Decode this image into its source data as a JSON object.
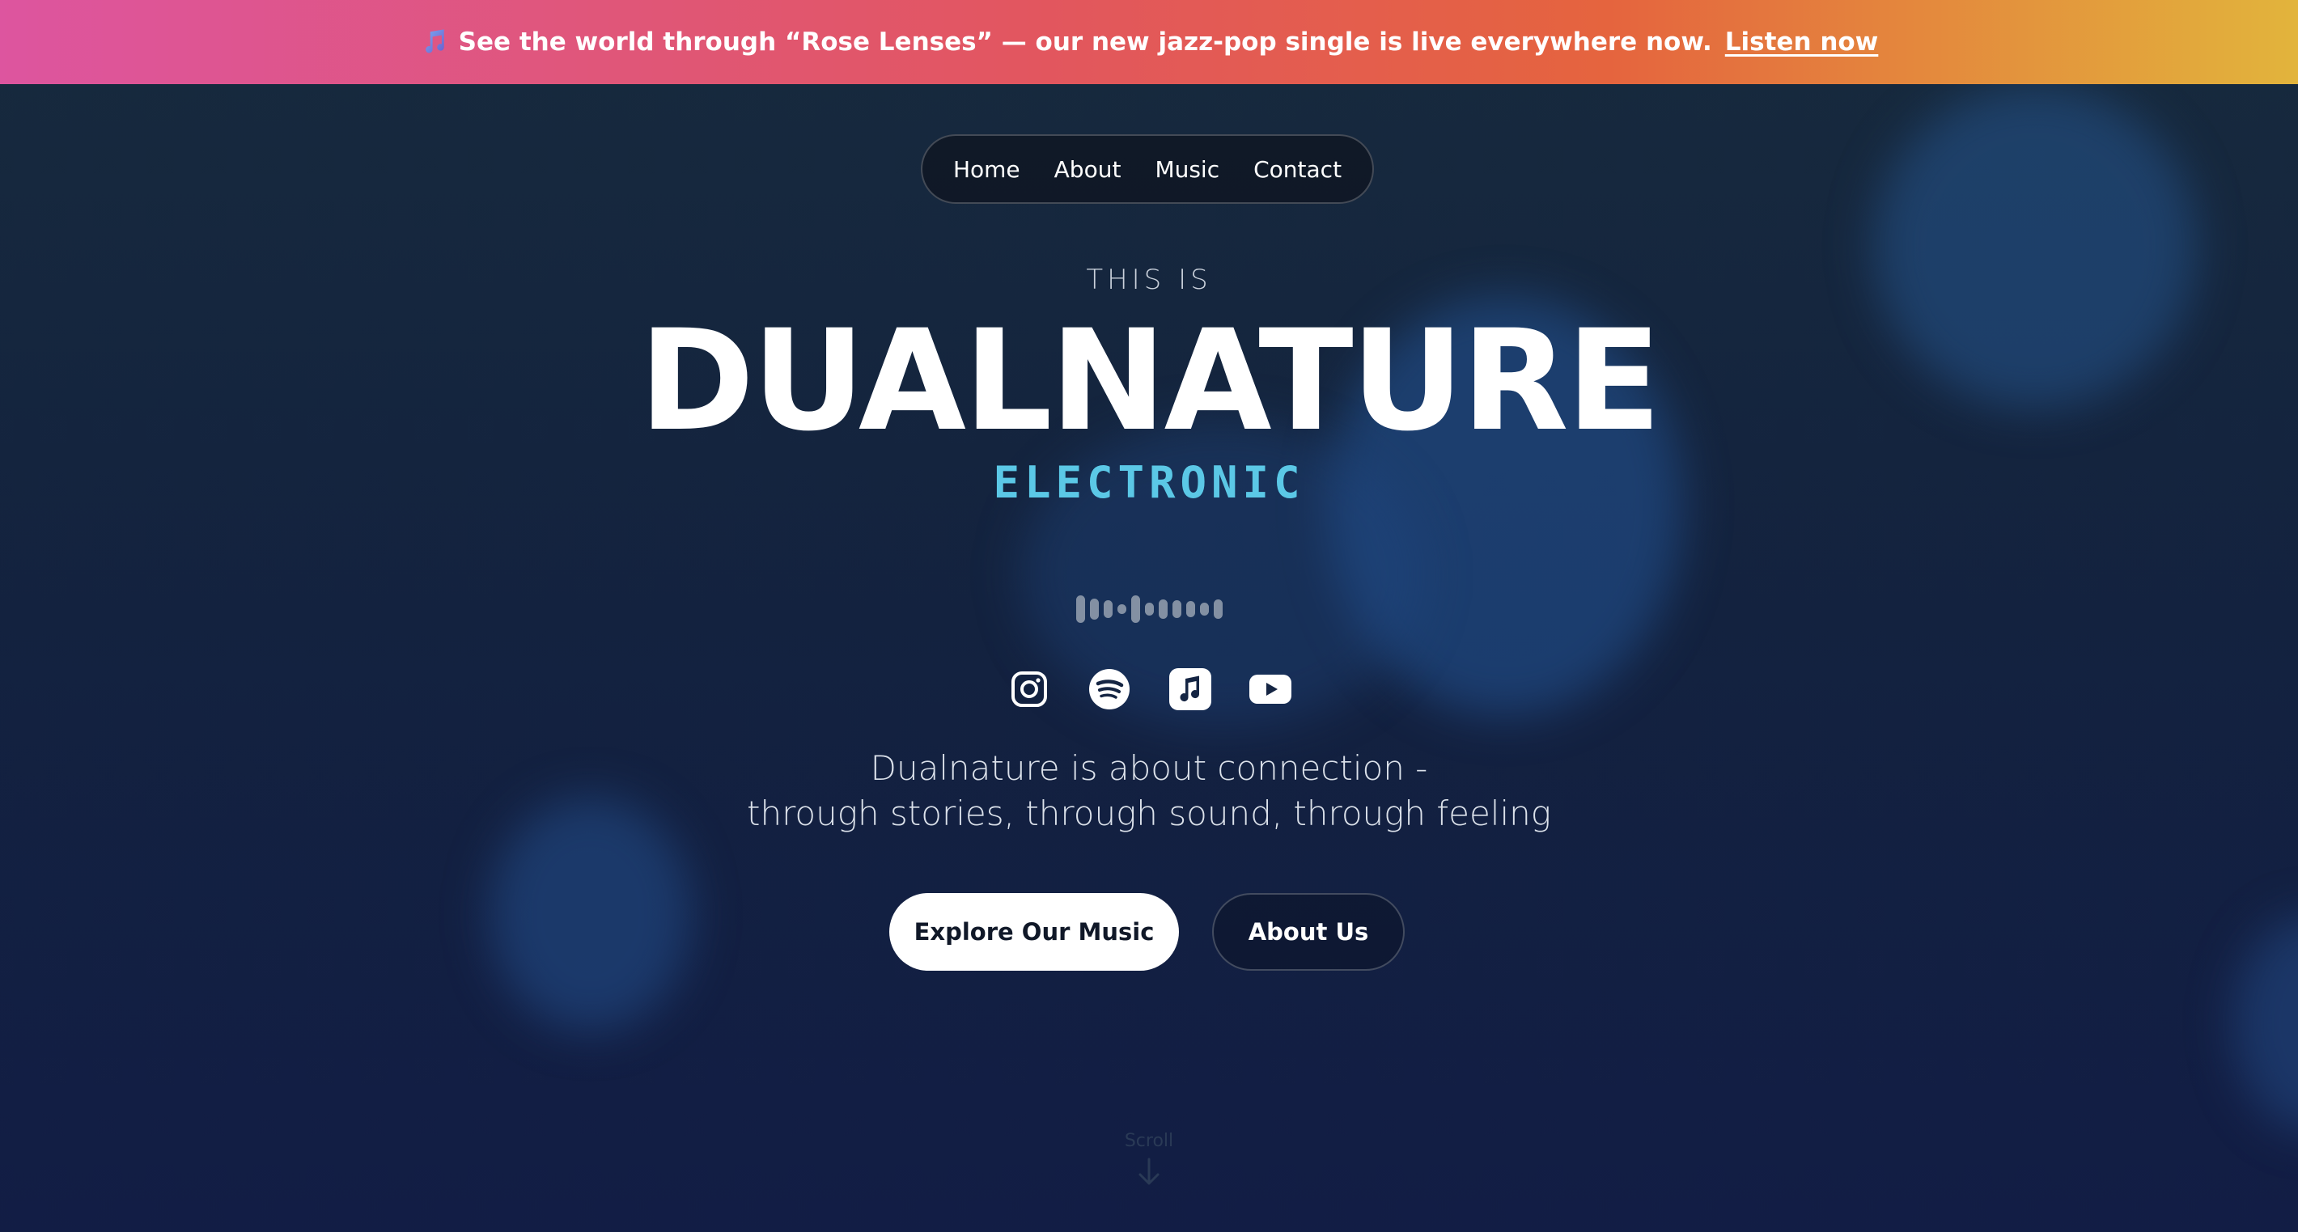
{
  "announcement": {
    "icon": "music-note-icon",
    "text": "See the world through “Rose Lenses” — our new jazz-pop single is live everywhere now.",
    "link_label": "Listen now",
    "gradient_colors": [
      "#dd559f",
      "#e2565f",
      "#e5643e",
      "#e2b43c"
    ]
  },
  "nav": {
    "items": [
      {
        "label": "Home"
      },
      {
        "label": "About"
      },
      {
        "label": "Music"
      },
      {
        "label": "Contact"
      }
    ]
  },
  "hero": {
    "eyebrow": "THIS IS",
    "title": "DUALNATURE",
    "genre": "ELECTRONIC",
    "genre_color": "#5bc8e6",
    "waveform_icon": "audio-waveform-icon",
    "socials": [
      {
        "icon": "instagram-icon"
      },
      {
        "icon": "spotify-icon"
      },
      {
        "icon": "apple-music-icon"
      },
      {
        "icon": "youtube-icon"
      }
    ],
    "tagline_line1": "Dualnature is about connection -",
    "tagline_line2": "through stories, through sound, through feeling",
    "primary_button": "Explore Our Music",
    "secondary_button": "About Us",
    "scroll_label": "Scroll",
    "scroll_icon": "arrow-down-icon"
  },
  "colors": {
    "background_top": "#172a3d",
    "background_bottom": "#121d45",
    "blob": "#25548c"
  }
}
